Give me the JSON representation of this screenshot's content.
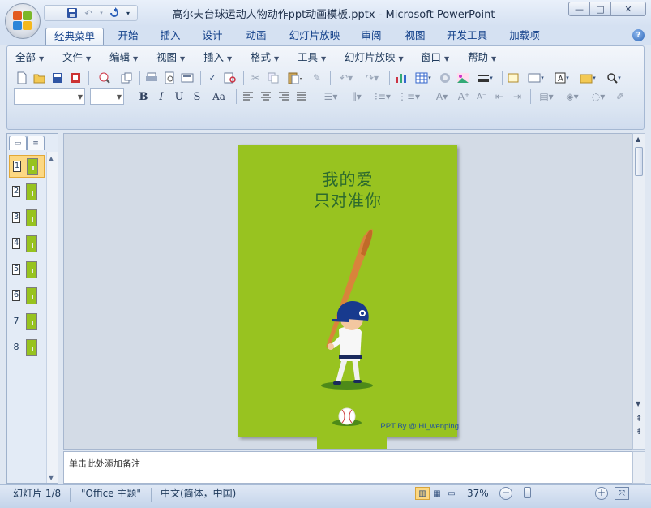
{
  "window": {
    "title": "高尔夫台球运动人物动作ppt动画模板.pptx - Microsoft PowerPoint",
    "minimize": "—",
    "maximize": "□",
    "close": "✕"
  },
  "ribbon_tabs": [
    "经典菜单",
    "开始",
    "插入",
    "设计",
    "动画",
    "幻灯片放映",
    "审阅",
    "视图",
    "开发工具",
    "加载项"
  ],
  "menus": [
    "全部",
    "文件",
    "编辑",
    "视图",
    "插入",
    "格式",
    "工具",
    "幻灯片放映",
    "窗口",
    "帮助"
  ],
  "format_buttons": {
    "bold": "B",
    "italic": "I",
    "underline": "U",
    "shadow": "S",
    "case": "Aa"
  },
  "thumbnails": [
    "1",
    "2",
    "3",
    "4",
    "5",
    "6",
    "7",
    "8"
  ],
  "slide": {
    "title_line1": "我的爱",
    "title_line2": "只对准你",
    "credit": "PPT By @ Hi_wenping",
    "background": "#98c320"
  },
  "notes_placeholder": "单击此处添加备注",
  "status": {
    "slide_indicator": "幻灯片 1/8",
    "theme": "\"Office 主题\"",
    "language": "中文(简体，中国)",
    "zoom": "37%",
    "zoom_level_percent": 37
  },
  "colors": {
    "accent": "#fcd883",
    "ribbon_text": "#15428b",
    "slide_green": "#98c320"
  }
}
